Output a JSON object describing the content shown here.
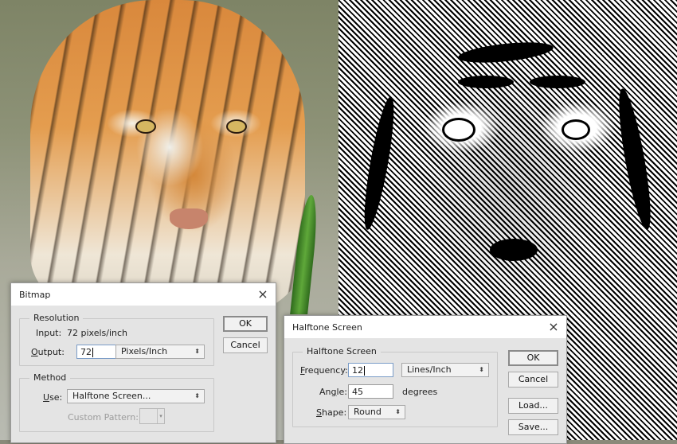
{
  "images": {
    "left_photo": {
      "description": "color tiger photo",
      "icon": "photo-image"
    },
    "right_photo": {
      "description": "bitmap halftone tiger",
      "icon": "halftone-image"
    }
  },
  "bitmap_dialog": {
    "title": "Bitmap",
    "close_icon": "×",
    "resolution_group": {
      "legend": "Resolution",
      "input_label": "Input:",
      "input_value": "72 pixels/inch",
      "output_label_prefix": "",
      "output_label_underlined": "O",
      "output_label_rest": "utput:",
      "output_value": "72",
      "output_unit": "Pixels/Inch"
    },
    "method_group": {
      "legend": "Method",
      "use_label_underlined": "U",
      "use_label_rest": "se:",
      "use_value": "Halftone Screen...",
      "custom_pattern_label": "Custom Pattern:"
    },
    "buttons": {
      "ok": "OK",
      "cancel": "Cancel"
    }
  },
  "halftone_dialog": {
    "title": "Halftone Screen",
    "close_icon": "×",
    "group_legend": "Halftone Screen",
    "frequency": {
      "label_underlined": "F",
      "label_rest": "requency:",
      "value": "12",
      "unit": "Lines/Inch"
    },
    "angle": {
      "label_pre": "An",
      "label_underlined": "g",
      "label_rest": "le:",
      "value": "45",
      "unit": "degrees"
    },
    "shape": {
      "label_underlined": "S",
      "label_rest": "hape:",
      "value": "Round"
    },
    "buttons": {
      "ok": "OK",
      "cancel": "Cancel",
      "load": "Load...",
      "save": "Save..."
    }
  },
  "select_arrows": "⬍",
  "dropdown_arrow": "▾"
}
